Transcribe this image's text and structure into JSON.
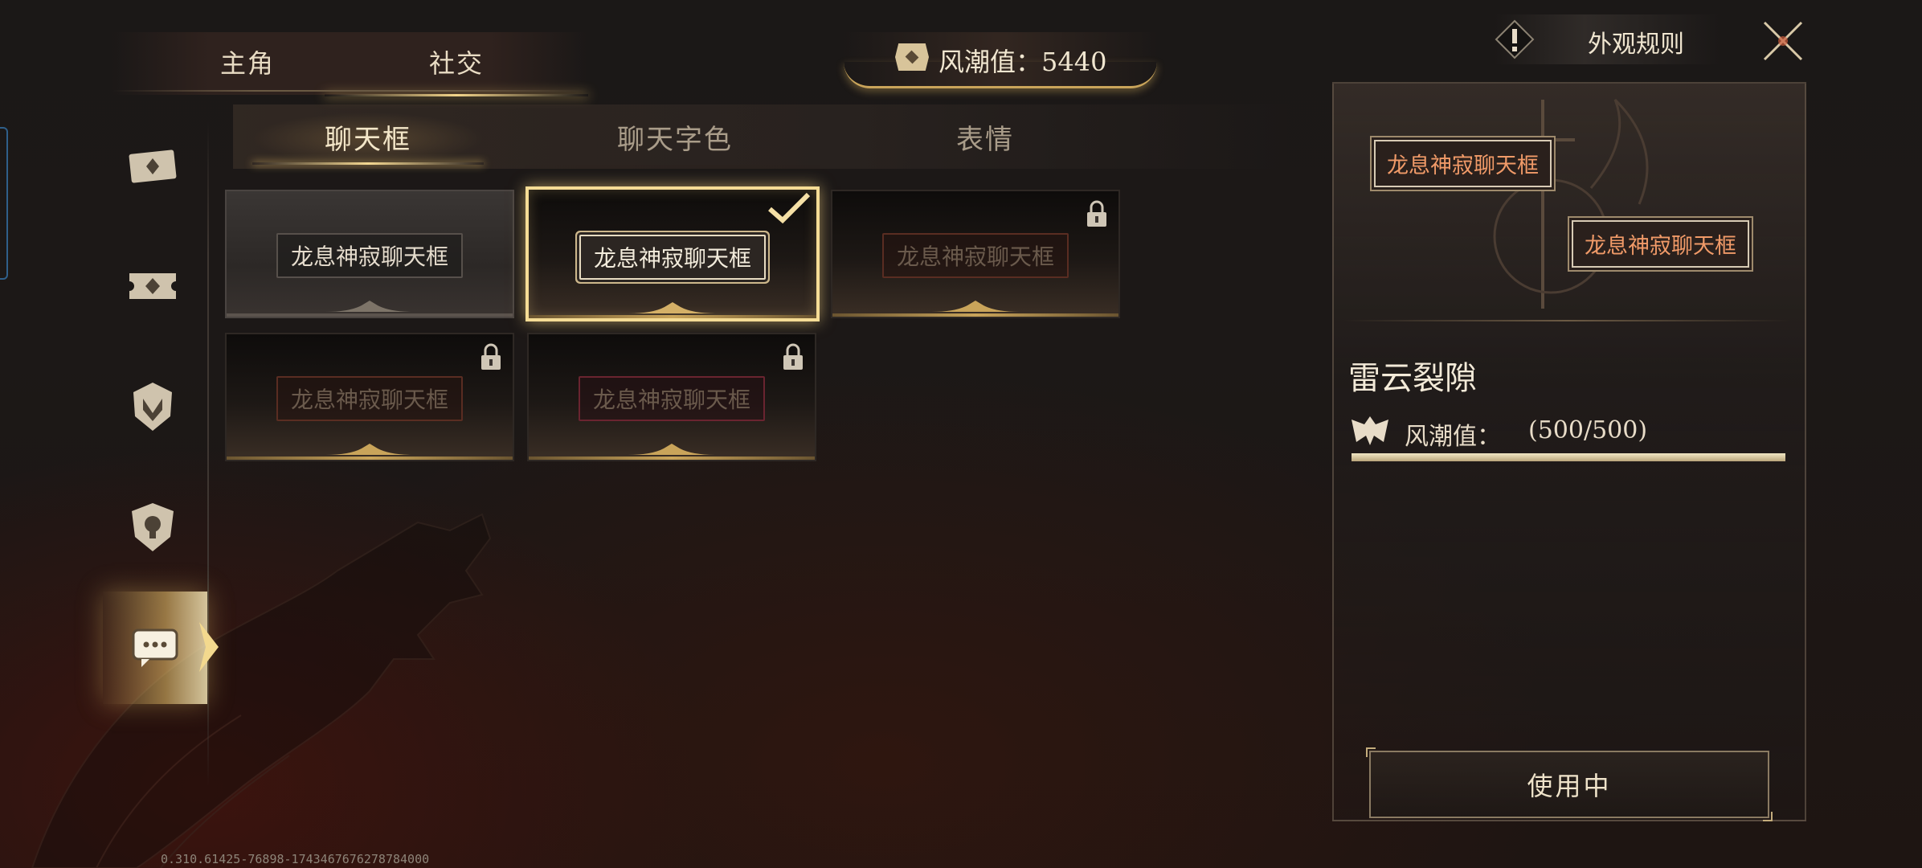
{
  "top_tabs": [
    {
      "label": "主角",
      "active": false
    },
    {
      "label": "社交",
      "active": true
    }
  ],
  "currency": {
    "label": "风潮值：5440",
    "icon": "currency-badge-icon"
  },
  "rules": {
    "label": "外观规则",
    "icon": "exclamation-icon"
  },
  "close": {
    "icon": "close-icon"
  },
  "left_nav": [
    {
      "icon": "ticket-card-icon",
      "active": false
    },
    {
      "icon": "ticket-stub-icon",
      "active": false
    },
    {
      "icon": "helmet-icon",
      "active": false
    },
    {
      "icon": "shield-icon",
      "active": false
    },
    {
      "icon": "chat-bubble-icon",
      "active": true
    }
  ],
  "sub_tabs": [
    {
      "label": "聊天框",
      "active": true
    },
    {
      "label": "聊天字色",
      "active": false
    },
    {
      "label": "表情",
      "active": false
    }
  ],
  "items": [
    {
      "label": "龙息神寂聊天框",
      "style": "default",
      "selected": false,
      "locked": false
    },
    {
      "label": "龙息神寂聊天框",
      "style": "gold",
      "selected": true,
      "locked": false
    },
    {
      "label": "龙息神寂聊天框",
      "style": "dim",
      "selected": false,
      "locked": true
    },
    {
      "label": "龙息神寂聊天框",
      "style": "dim",
      "selected": false,
      "locked": true
    },
    {
      "label": "龙息神寂聊天框",
      "style": "dim-red",
      "selected": false,
      "locked": true
    }
  ],
  "detail": {
    "preview_labels": [
      "龙息神寂聊天框",
      "龙息神寂聊天框"
    ],
    "name": "雷云裂隙",
    "progress_label": "风潮值：",
    "progress_value": "(500/500)",
    "progress_fraction": 1.0,
    "button_label": "使用中"
  },
  "version": "0.310.61425-76898-1743467676278784000",
  "colors": {
    "accent_gold": "#f2d48a",
    "preview_text": "#f09a68",
    "background": "#1b1817"
  }
}
